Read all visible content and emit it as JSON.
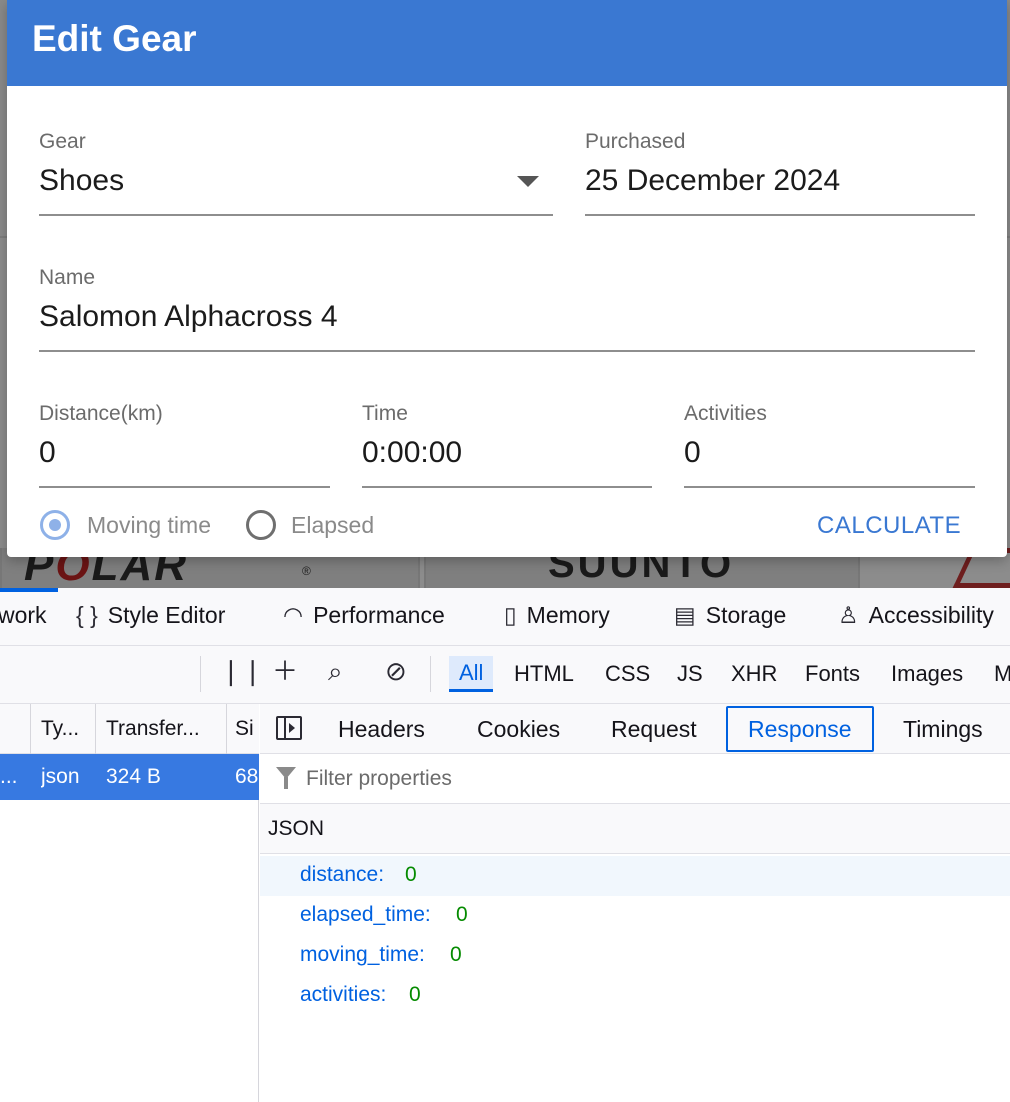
{
  "dialog": {
    "title": "Edit Gear",
    "gear": {
      "label": "Gear",
      "value": "Shoes"
    },
    "purchased": {
      "label": "Purchased",
      "value": "25 December 2024"
    },
    "name": {
      "label": "Name",
      "value": "Salomon Alphacross 4"
    },
    "distance": {
      "label": "Distance(km)",
      "value": "0"
    },
    "time": {
      "label": "Time",
      "value": "0:00:00"
    },
    "activities": {
      "label": "Activities",
      "value": "0"
    },
    "radio_moving": "Moving time",
    "radio_elapsed": "Elapsed",
    "calculate": "CALCULATE"
  },
  "background": {
    "logo_polar_1": "P",
    "logo_polar_2": "O",
    "logo_polar_3": "LAR",
    "logo_polar_reg": "®",
    "logo_suunto": "SUUNTO"
  },
  "devtools": {
    "tabs": [
      "work",
      "Style Editor",
      "Performance",
      "Memory",
      "Storage",
      "Accessibility"
    ],
    "filters": [
      "All",
      "HTML",
      "CSS",
      "JS",
      "XHR",
      "Fonts",
      "Images",
      "M"
    ],
    "columns": [
      "Ty...",
      "Transfer...",
      "Si"
    ],
    "row": {
      "type": "json",
      "transfer": "324 B",
      "size": "68",
      "name": "..."
    },
    "detail_tabs": [
      "Headers",
      "Cookies",
      "Request",
      "Response",
      "Timings"
    ],
    "filter_placeholder": "Filter properties",
    "json_title": "JSON",
    "json": [
      {
        "key": "distance:",
        "value": "0"
      },
      {
        "key": "elapsed_time:",
        "value": "0"
      },
      {
        "key": "moving_time:",
        "value": "0"
      },
      {
        "key": "activities:",
        "value": "0"
      }
    ]
  }
}
